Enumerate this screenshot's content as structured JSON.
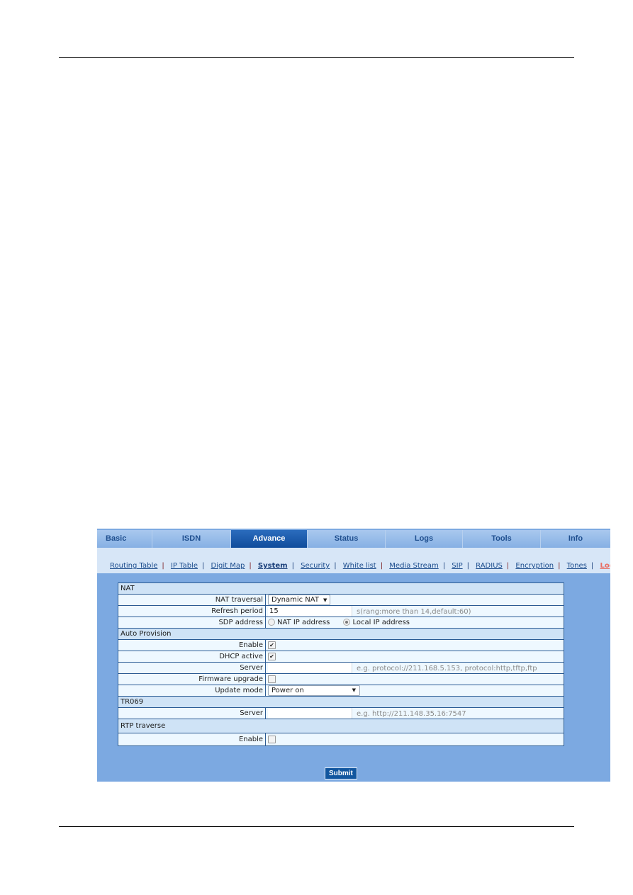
{
  "tabs": [
    {
      "label": "Basic",
      "active": false
    },
    {
      "label": "ISDN",
      "active": false
    },
    {
      "label": "Advance",
      "active": true
    },
    {
      "label": "Status",
      "active": false
    },
    {
      "label": "Logs",
      "active": false
    },
    {
      "label": "Tools",
      "active": false
    },
    {
      "label": "Info",
      "active": false
    }
  ],
  "subnav": {
    "links": [
      "Routing Table",
      "IP Table",
      "Digit Map",
      "System",
      "Security",
      "White list",
      "Media Stream",
      "SIP",
      "RADIUS",
      "Encryption",
      "Tones"
    ],
    "current": "System",
    "logout": "Logout"
  },
  "form": {
    "nat": {
      "section_title": "NAT",
      "nat_traversal": {
        "label": "NAT traversal",
        "value": "Dynamic NAT"
      },
      "refresh_period": {
        "label": "Refresh period",
        "value": "15",
        "hint": "s(rang:more than 14,default:60)"
      },
      "sdp_address": {
        "label": "SDP address",
        "options": [
          "NAT IP address",
          "Local IP address"
        ],
        "selected": "Local IP address"
      }
    },
    "auto_provision": {
      "section_title": "Auto Provision",
      "enable": {
        "label": "Enable",
        "checked": true
      },
      "dhcp_active": {
        "label": "DHCP active",
        "checked": true
      },
      "server": {
        "label": "Server",
        "value": "",
        "hint": "e.g. protocol://211.168.5.153, protocol:http,tftp,ftp"
      },
      "firmware_upgrade": {
        "label": "Firmware upgrade",
        "checked": false
      },
      "update_mode": {
        "label": "Update mode",
        "value": "Power on"
      }
    },
    "tr069": {
      "section_title": "TR069",
      "server": {
        "label": "Server",
        "value": "",
        "hint": "e.g. http://211.148.35.16:7547"
      }
    },
    "rtp_traverse": {
      "section_title": "RTP traverse",
      "enable": {
        "label": "Enable",
        "checked": false
      }
    }
  },
  "submit_label": "Submit",
  "icons": {
    "check": "✔",
    "dropdown": "▼"
  }
}
